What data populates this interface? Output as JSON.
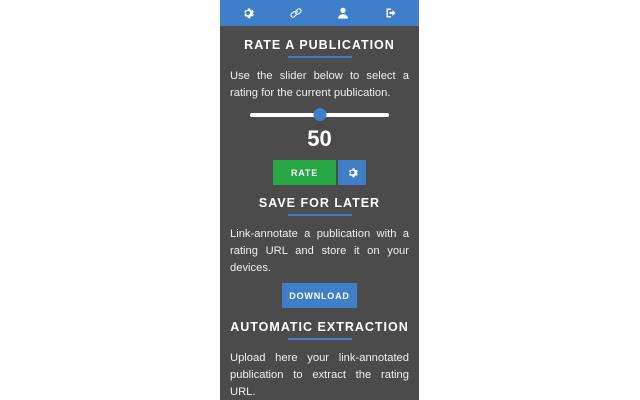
{
  "topbar": {
    "icons": [
      "gear-icon",
      "link-icon",
      "user-icon",
      "sign-out-icon"
    ]
  },
  "rate_section": {
    "heading": "RATE A PUBLICATION",
    "description": "Use the slider below to select a rating for the current publication.",
    "slider_value": 50,
    "slider_min": 0,
    "slider_max": 100,
    "value_display": "50",
    "rate_button_label": "RATE",
    "settings_icon": "gear-icon"
  },
  "save_section": {
    "heading": "SAVE FOR LATER",
    "description": "Link-annotate a publication with a rating URL and store it on your devices.",
    "download_button_label": "DOWNLOAD"
  },
  "extract_section": {
    "heading": "AUTOMATIC EXTRACTION",
    "description": "Upload here your link-annotated publication to extract the rating URL."
  },
  "colors": {
    "accent": "#3f7ec9",
    "panel_bg": "#4b4b4b",
    "rate_button": "#28a745"
  }
}
